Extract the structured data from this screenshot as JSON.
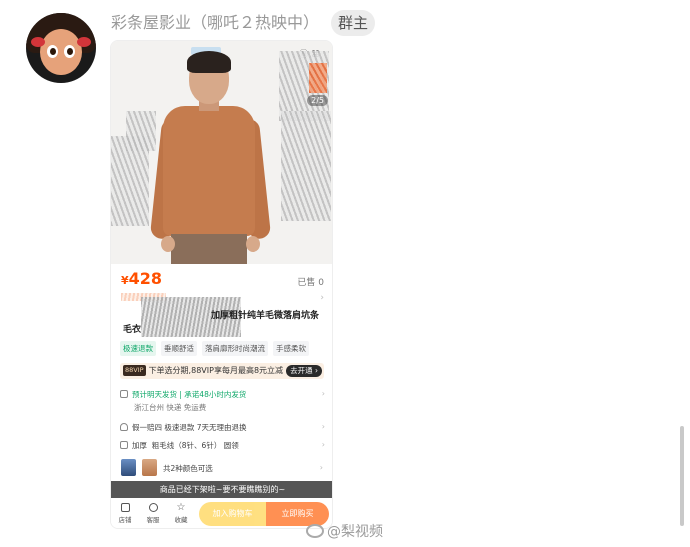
{
  "sender": {
    "name": "彩条屋影业（哪吒２热映中）",
    "badge": "群主"
  },
  "product": {
    "image_counter": "2/5",
    "price_symbol": "¥",
    "price": "428",
    "sold": "已售 0",
    "title_line1": "加厚粗针纯羊毛微落肩坑条",
    "title_line2": "毛衣",
    "tags": [
      "极速退款",
      "垂顺舒适",
      "落肩廓形时尚潮流",
      "手感柔软"
    ],
    "vip_tag": "88VIP",
    "vip_text": "下单选分期,88VIP享每月最高8元立减",
    "vip_button": "去开通 ›",
    "shipping_main": "预计明天发货 | 承诺48小时内发货",
    "shipping_sub": "浙江台州  快递  免运费",
    "guarantee": "假一赔四   极速退款   7天无理由退换",
    "params_label": "加厚",
    "params": "粗毛线（8针、6针）   圆领",
    "colors": "共2种颜色可选",
    "offline_notice": "商品已经下架啦~要不要瞧瞧别的~",
    "bottom": {
      "store": "店铺",
      "service": "客服",
      "favorite": "收藏",
      "add_cart": "加入购物车",
      "buy_now": "立即购买"
    }
  },
  "watermark": "@梨视频",
  "colors": {
    "price": "#ff5000",
    "green": "#10a86a",
    "cart": "#ffc61a",
    "buy": "#ff6b1a"
  }
}
